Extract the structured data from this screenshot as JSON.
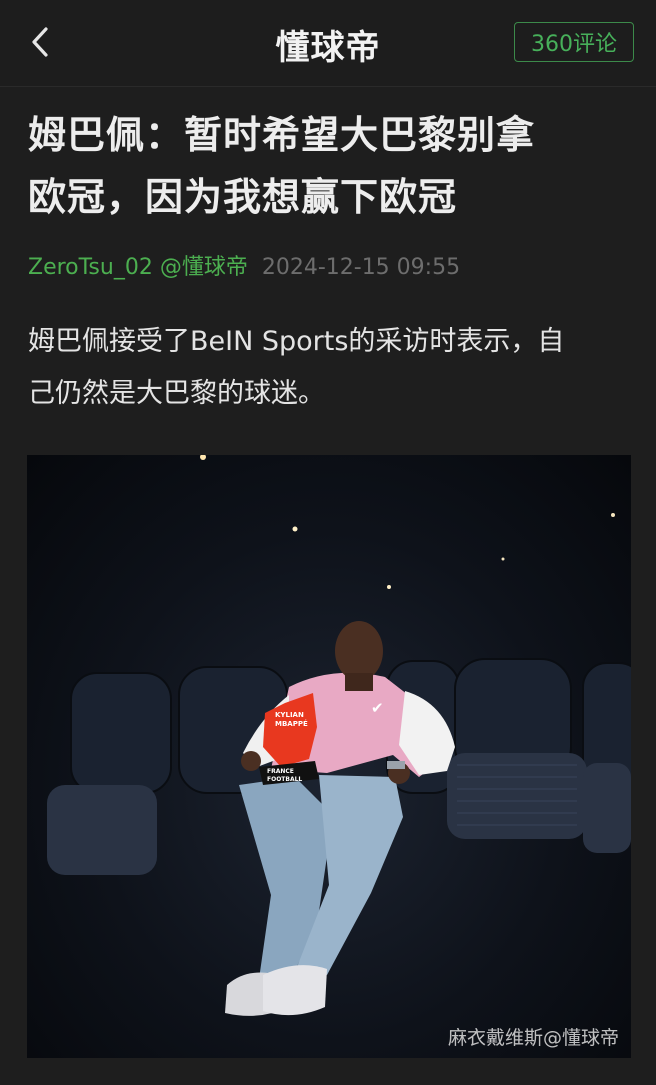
{
  "header": {
    "back_icon": "chevron-left-icon",
    "title": "懂球帝",
    "comments_label": "360评论"
  },
  "article": {
    "headline_line1": "姆巴佩：暂时希望大巴黎别拿",
    "headline_line2": "欧冠，因为我想赢下欧冠",
    "author": "ZeroTsu_02 @懂球帝",
    "timestamp": "2024-12-15 09:55",
    "body_line1": "姆巴佩接受了BeIN Sports的采访时表示，自",
    "body_line2": "己仍然是大巴黎的球迷。"
  },
  "photo": {
    "trophy_name_line1": "KYLIAN",
    "trophy_name_line2": "MBAPPÉ",
    "plaque_line1": "FRANCE",
    "plaque_line2": "FOOTBALL",
    "watermark": "麻衣戴维斯@懂球帝"
  },
  "colors": {
    "background": "#1e1e1e",
    "accent_green": "#4caf50",
    "comments_border": "#3c8a4a",
    "meta_gray": "#6d6d6d",
    "trophy_red": "#e8381f",
    "jacket_pink": "#e8a9c4"
  }
}
